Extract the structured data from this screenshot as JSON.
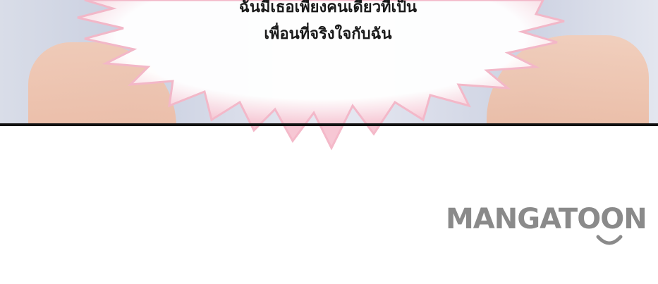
{
  "speech": {
    "line1": "ฉันมีเธอเพียงคนเดียวที่เป็น",
    "line2": "เพื่อนที่จริงใจกับฉัน"
  },
  "watermark": {
    "text": "MANGATOON",
    "color": "#8a8a8a"
  },
  "colors": {
    "border": "#111111",
    "burst_edge": "#f4b7c8",
    "hair": "#f0c1a8",
    "background": "#ffffff"
  }
}
